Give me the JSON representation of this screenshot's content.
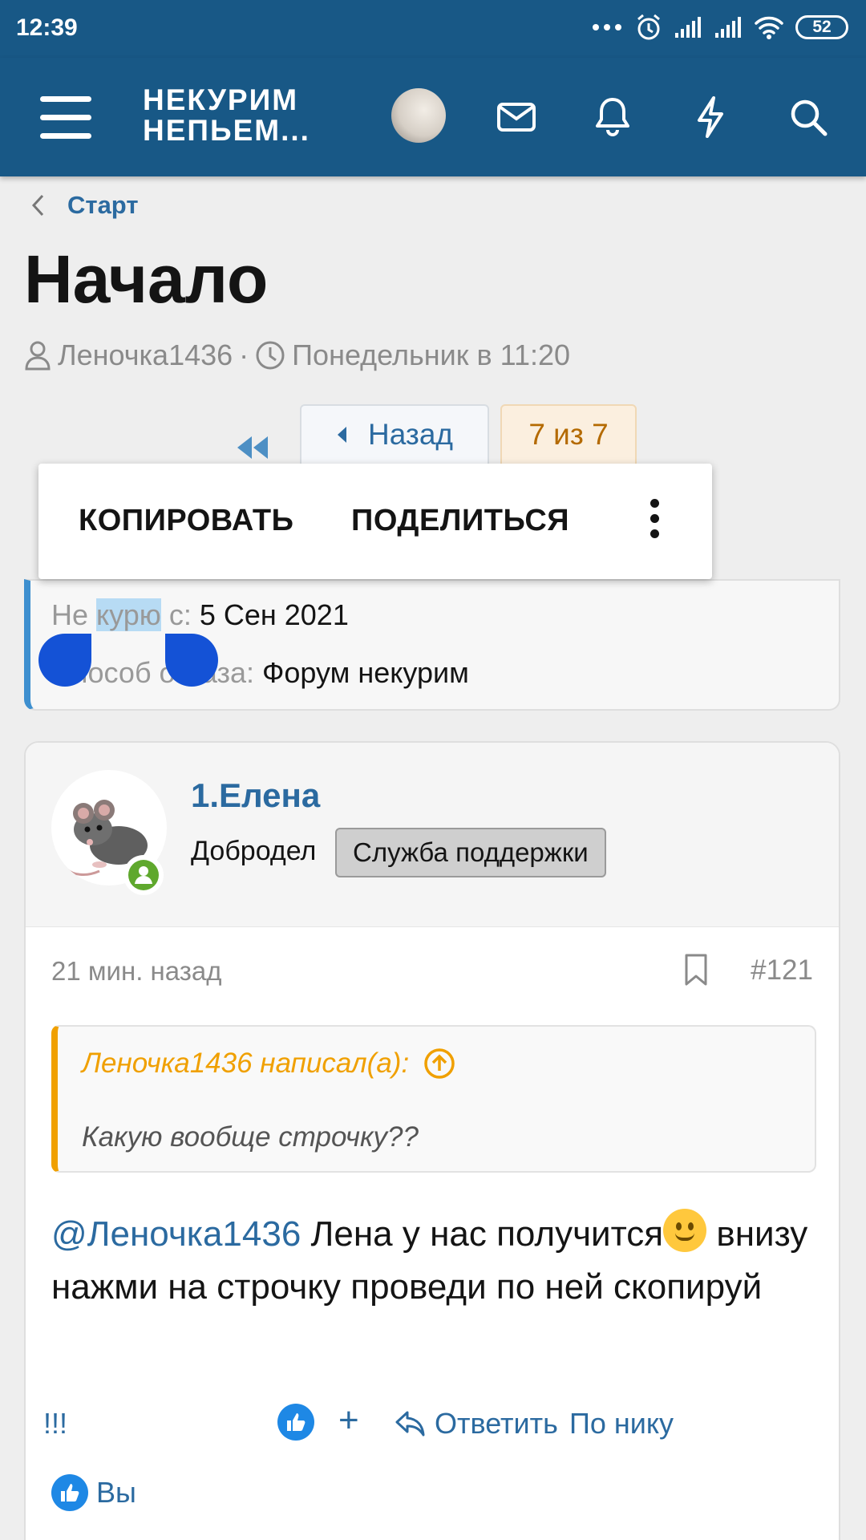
{
  "status_bar": {
    "time": "12:39",
    "battery": "52"
  },
  "header": {
    "logo_line1": "НЕКУРИМ",
    "logo_line2": "НЕПЬЕМ..."
  },
  "breadcrumb": {
    "link": "Старт"
  },
  "thread": {
    "title": "Начало",
    "author": "Леночка1436",
    "separator": "·",
    "date": "Понедельник в 11:20"
  },
  "pager": {
    "prev_label": "Назад",
    "current": "7 из 7"
  },
  "context_menu": {
    "copy": "КОПИРОВАТЬ",
    "share": "ПОДЕЛИТЬСЯ"
  },
  "info": {
    "row1_label_before": "Не ",
    "row1_selected": "курю",
    "row1_label_after": " с: ",
    "row1_value": "5 Сен 2021",
    "row2_label": "Способ отказа: ",
    "row2_value": "Форум некурим"
  },
  "post": {
    "username": "1.Елена",
    "user_title": "Добродел",
    "banner": "Служба поддержки",
    "date": "21 мин. назад",
    "number": "#121",
    "quote_author": "Леночка1436 написал(а):",
    "quote_text": "Какую вообще строчку??",
    "mention": "@Леночка1436",
    "text_part1": " Лена у нас получится",
    "text_part2": "внизу нажми на строчку проведи по ней скопируй",
    "actions": {
      "report": "!!!",
      "add": "+",
      "reply": "Ответить",
      "by_nick": "По нику"
    },
    "reactions_label": "Вы"
  },
  "colors": {
    "header": "#185886",
    "link": "#2b6aa0",
    "quote_accent": "#f0a000",
    "info_accent": "#3d8fcf",
    "selection_handle": "#1452d6"
  }
}
